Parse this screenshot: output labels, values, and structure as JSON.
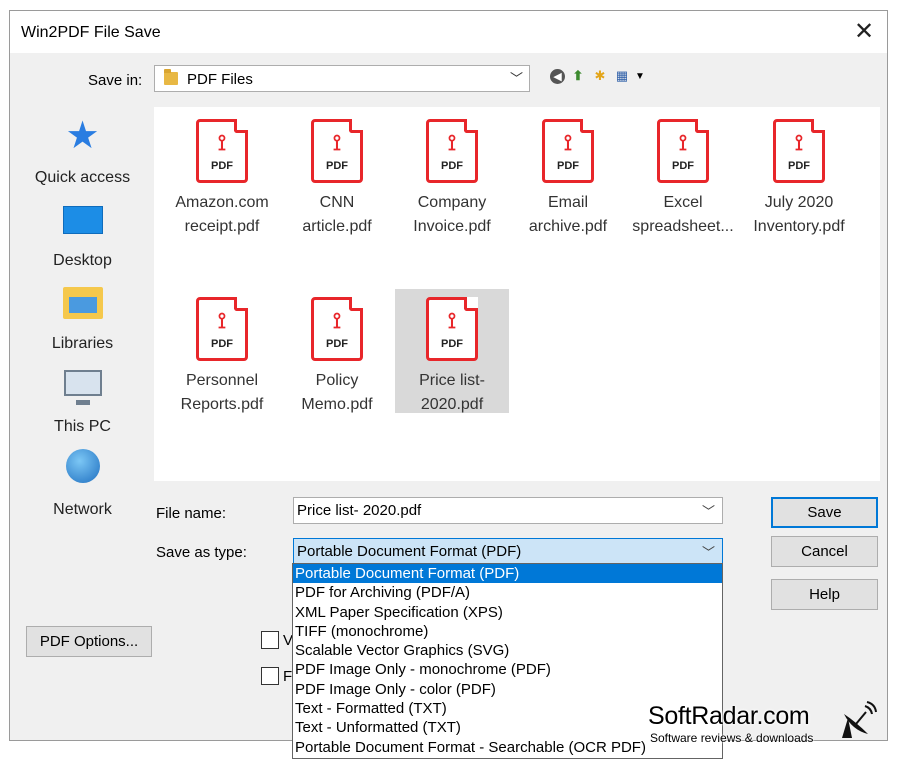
{
  "window": {
    "title": "Win2PDF File Save",
    "close_glyph": "✕"
  },
  "save_in": {
    "label": "Save in:",
    "value": "PDF Files"
  },
  "toolbar": {
    "icons": [
      "back-icon",
      "up-folder-icon",
      "new-folder-icon",
      "view-menu-icon"
    ]
  },
  "places": [
    {
      "label": "Quick access",
      "icon": "quick-access-star-icon"
    },
    {
      "label": "Desktop",
      "icon": "desktop-icon"
    },
    {
      "label": "Libraries",
      "icon": "libraries-icon"
    },
    {
      "label": "This PC",
      "icon": "this-pc-icon"
    },
    {
      "label": "Network",
      "icon": "network-icon"
    }
  ],
  "files": [
    {
      "line1": "Amazon.com",
      "line2": "receipt.pdf",
      "selected": false
    },
    {
      "line1": "CNN",
      "line2": "article.pdf",
      "selected": false
    },
    {
      "line1": "Company",
      "line2": "Invoice.pdf",
      "selected": false
    },
    {
      "line1": "Email",
      "line2": "archive.pdf",
      "selected": false
    },
    {
      "line1": "Excel",
      "line2": "spreadsheet...",
      "selected": false
    },
    {
      "line1": "July 2020",
      "line2": "Inventory.pdf",
      "selected": false
    },
    {
      "line1": "Personnel",
      "line2": "Reports.pdf",
      "selected": false
    },
    {
      "line1": "Policy",
      "line2": "Memo.pdf",
      "selected": false
    },
    {
      "line1": "Price list-",
      "line2": "2020.pdf",
      "selected": true
    }
  ],
  "pdf_icon_text": "PDF",
  "form": {
    "file_name_label": "File name:",
    "file_name_value": "Price list- 2020.pdf",
    "save_as_type_label": "Save as type:",
    "save_as_type_value": "Portable Document Format (PDF)"
  },
  "type_options": [
    "Portable Document Format (PDF)",
    "PDF for Archiving (PDF/A)",
    "XML Paper Specification (XPS)",
    "TIFF (monochrome)",
    "Scalable Vector Graphics (SVG)",
    "PDF Image Only - monochrome (PDF)",
    "PDF Image Only - color (PDF)",
    "Text - Formatted (TXT)",
    "Text - Unformatted (TXT)",
    "Portable Document Format - Searchable (OCR PDF)"
  ],
  "selected_option_index": 0,
  "buttons": {
    "save": "Save",
    "cancel": "Cancel",
    "help": "Help",
    "pdf_options": "PDF Options..."
  },
  "checkboxes": [
    {
      "label_fragment": "V",
      "checked": false
    },
    {
      "label_fragment": "F",
      "checked": false
    }
  ],
  "watermark": {
    "brand": "SoftRadar.com",
    "tagline": "Software reviews & downloads"
  },
  "colors": {
    "accent": "#0078d7",
    "pdf_red": "#e8262a",
    "dialog_bg": "#f0f0f0",
    "selected_file_bg": "#d9d9d9"
  }
}
